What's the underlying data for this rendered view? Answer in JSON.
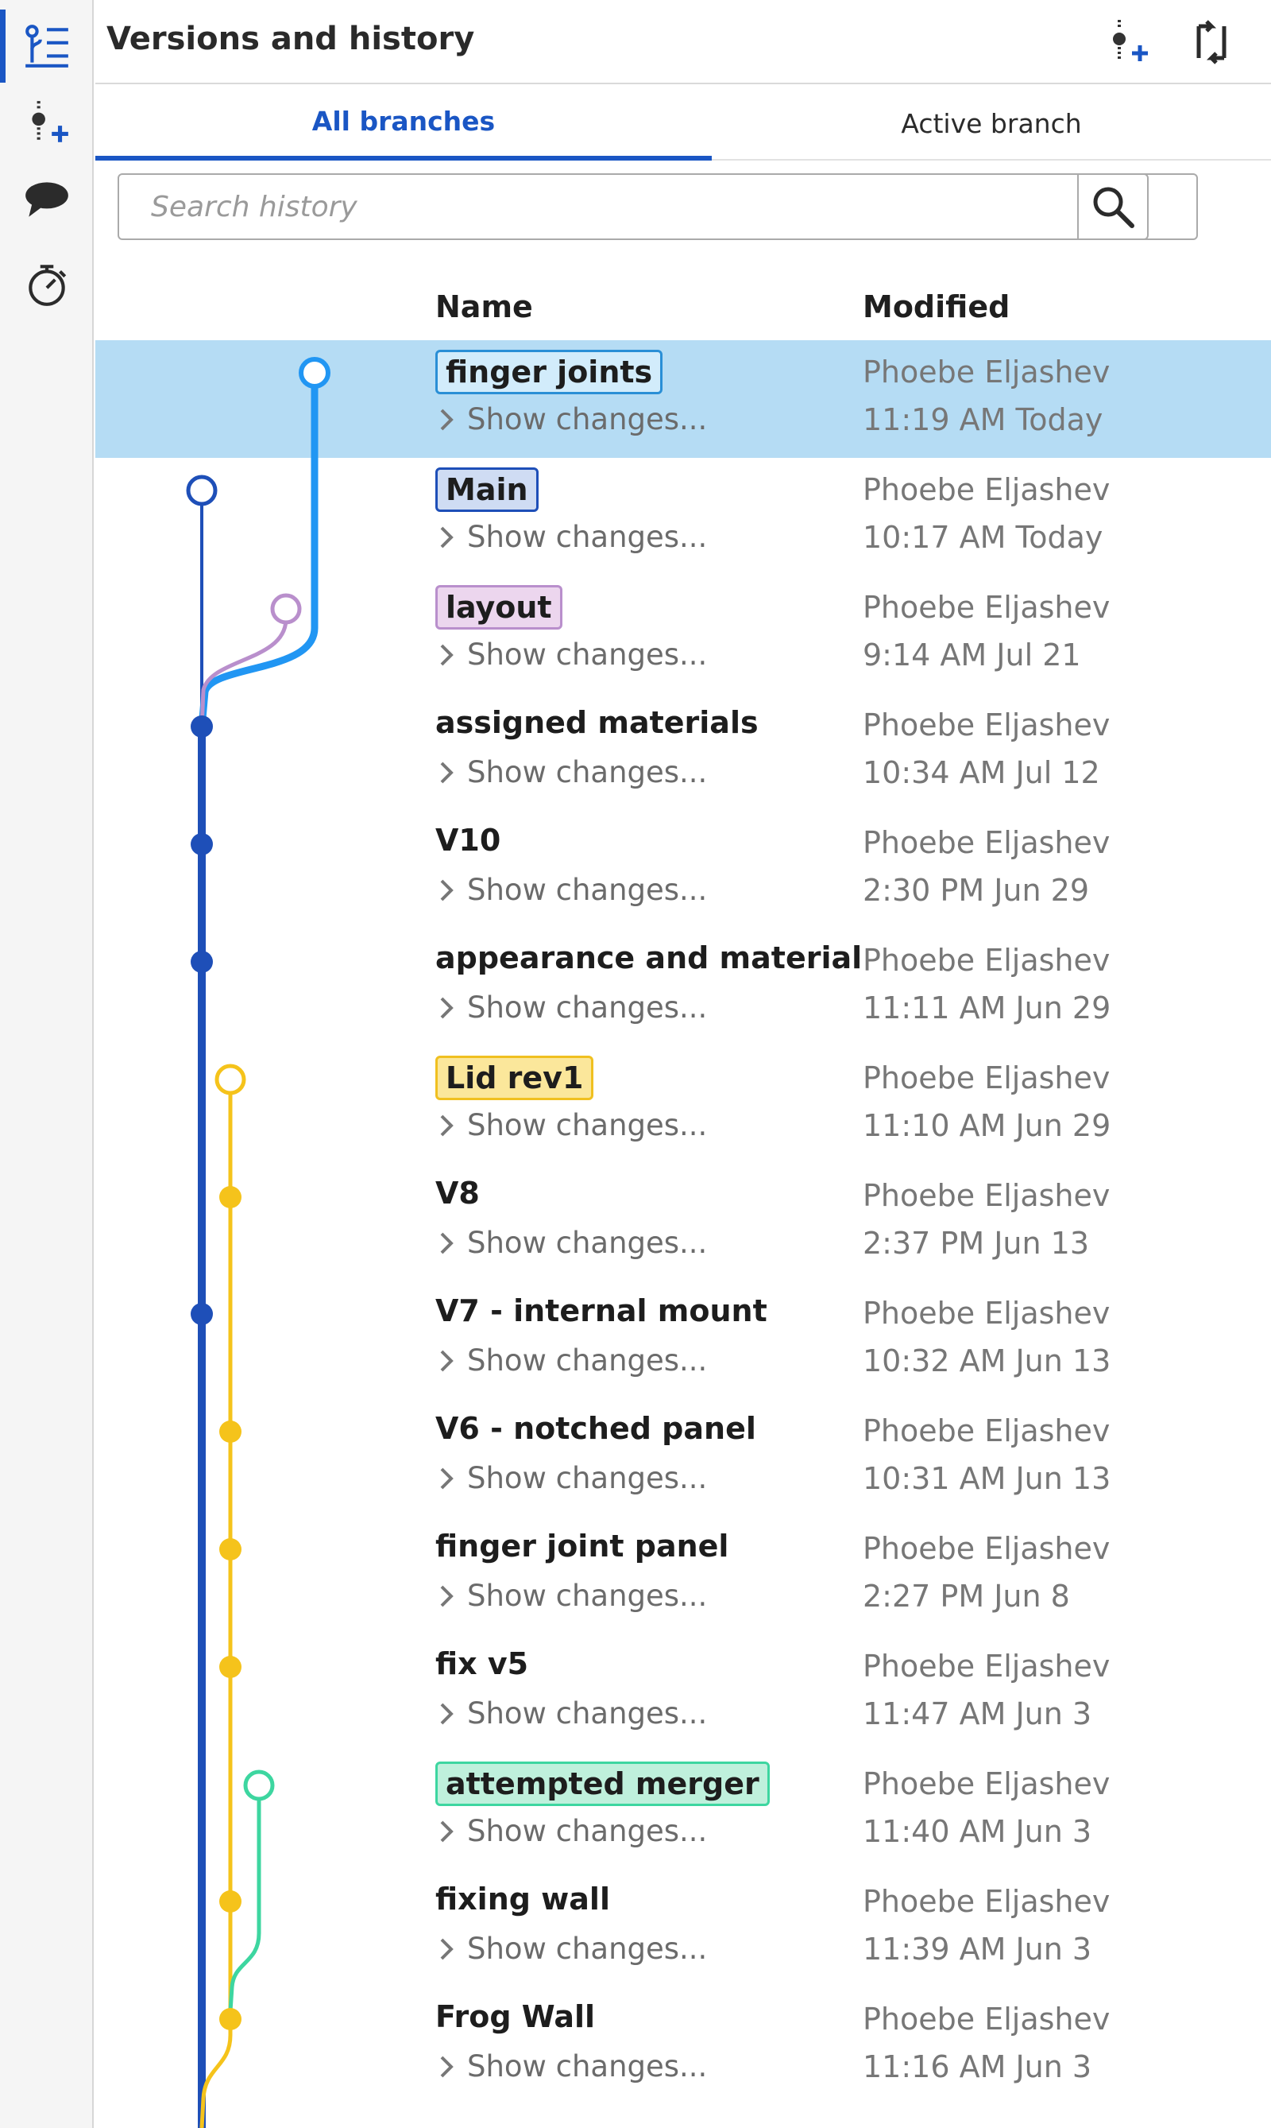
{
  "panel": {
    "title": "Versions and history"
  },
  "tabs": [
    {
      "label": "All branches",
      "active": true
    },
    {
      "label": "Active branch",
      "active": false
    }
  ],
  "search": {
    "placeholder": "Search history"
  },
  "columns": {
    "name": "Name",
    "modified": "Modified"
  },
  "rail_icons": [
    "versions-history-icon",
    "create-version-icon",
    "comments-icon",
    "timer-icon"
  ],
  "header_icons": [
    "create-version-icon",
    "branch-compare-icon"
  ],
  "colors": {
    "accent": "#1a56c4",
    "selected_row": "#b5dcf4",
    "main_branch": "#1e4fb8",
    "finger_joints_branch": "#2196f3",
    "layout_branch": "#b98fcc",
    "lid_branch": "#f5c31b",
    "merger_branch": "#3dd6a0"
  },
  "history": [
    {
      "name": "finger joints",
      "badge": "finger",
      "show_changes": "Show changes...",
      "modifier": "Phoebe Eljashev",
      "time": "11:19 AM Today",
      "selected": true
    },
    {
      "name": "Main",
      "badge": "main",
      "show_changes": "Show changes...",
      "modifier": "Phoebe Eljashev",
      "time": "10:17 AM Today"
    },
    {
      "name": "layout",
      "badge": "layout",
      "show_changes": "Show changes...",
      "modifier": "Phoebe Eljashev",
      "time": "9:14 AM Jul 21"
    },
    {
      "name": "assigned materials",
      "show_changes": "Show changes...",
      "modifier": "Phoebe Eljashev",
      "time": "10:34 AM Jul 12"
    },
    {
      "name": "V10",
      "show_changes": "Show changes...",
      "modifier": "Phoebe Eljashev",
      "time": "2:30 PM Jun 29"
    },
    {
      "name": "appearance and material",
      "show_changes": "Show changes...",
      "modifier": "Phoebe Eljashev",
      "time": "11:11 AM Jun 29"
    },
    {
      "name": "Lid rev1",
      "badge": "lid",
      "show_changes": "Show changes...",
      "modifier": "Phoebe Eljashev",
      "time": "11:10 AM Jun 29"
    },
    {
      "name": "V8",
      "show_changes": "Show changes...",
      "modifier": "Phoebe Eljashev",
      "time": "2:37 PM Jun 13"
    },
    {
      "name": "V7 - internal mount",
      "show_changes": "Show changes...",
      "modifier": "Phoebe Eljashev",
      "time": "10:32 AM Jun 13"
    },
    {
      "name": "V6 - notched panel",
      "show_changes": "Show changes...",
      "modifier": "Phoebe Eljashev",
      "time": "10:31 AM Jun 13"
    },
    {
      "name": "finger joint panel",
      "show_changes": "Show changes...",
      "modifier": "Phoebe Eljashev",
      "time": "2:27 PM Jun 8"
    },
    {
      "name": "fix v5",
      "show_changes": "Show changes...",
      "modifier": "Phoebe Eljashev",
      "time": "11:47 AM Jun 3"
    },
    {
      "name": "attempted merger",
      "badge": "merger",
      "show_changes": "Show changes...",
      "modifier": "Phoebe Eljashev",
      "time": "11:40 AM Jun 3"
    },
    {
      "name": "fixing wall",
      "show_changes": "Show changes...",
      "modifier": "Phoebe Eljashev",
      "time": "11:39 AM Jun 3"
    },
    {
      "name": "Frog Wall",
      "show_changes": "Show changes...",
      "modifier": "Phoebe Eljashev",
      "time": "11:16 AM Jun 3"
    }
  ]
}
